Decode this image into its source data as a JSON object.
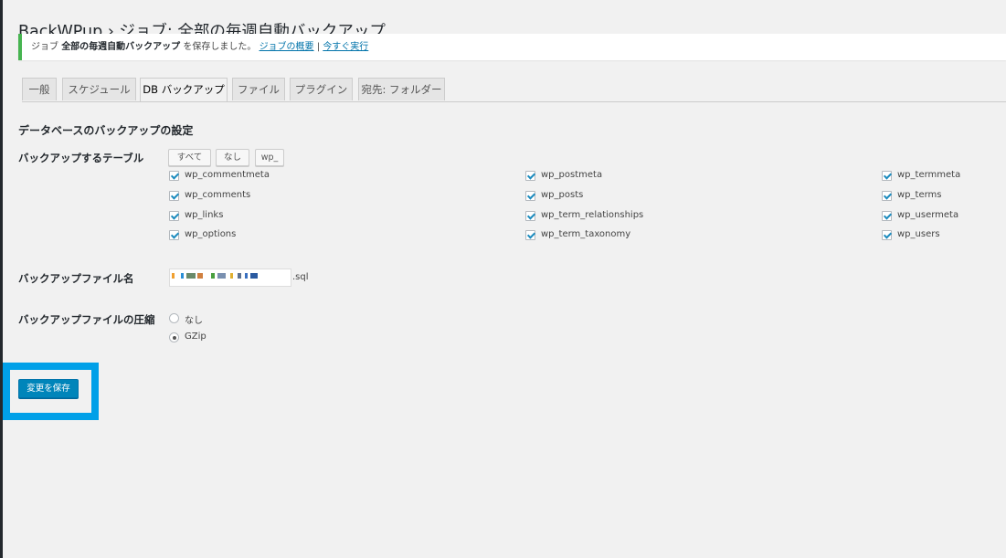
{
  "page": {
    "title_prefix": "BackWPup",
    "title_separator": "›",
    "title_rest": "ジョブ: 全部の毎週自動バックアップ"
  },
  "notice": {
    "prefix": "ジョブ",
    "job_name": "全部の毎週自動バックアップ",
    "saved_text": "を保存しました。",
    "overview_link": "ジョブの概要",
    "separator": "|",
    "run_now_link": "今すぐ実行"
  },
  "tabs": [
    {
      "label": "一般",
      "active": false
    },
    {
      "label": "スケジュール",
      "active": false
    },
    {
      "label": "DB バックアップ",
      "active": true
    },
    {
      "label": "ファイル",
      "active": false
    },
    {
      "label": "プラグイン",
      "active": false
    },
    {
      "label": "宛先: フォルダー",
      "active": false
    }
  ],
  "section_title": "データベースのバックアップの設定",
  "tables_section": {
    "label": "バックアップするテーブル",
    "buttons": [
      "すべて",
      "なし",
      "wp_"
    ],
    "columns": [
      [
        {
          "name": "wp_commentmeta",
          "checked": true
        },
        {
          "name": "wp_comments",
          "checked": true
        },
        {
          "name": "wp_links",
          "checked": true
        },
        {
          "name": "wp_options",
          "checked": true
        }
      ],
      [
        {
          "name": "wp_postmeta",
          "checked": true
        },
        {
          "name": "wp_posts",
          "checked": true
        },
        {
          "name": "wp_term_relationships",
          "checked": true
        },
        {
          "name": "wp_term_taxonomy",
          "checked": true
        }
      ],
      [
        {
          "name": "wp_termmeta",
          "checked": true
        },
        {
          "name": "wp_terms",
          "checked": true
        },
        {
          "name": "wp_usermeta",
          "checked": true
        },
        {
          "name": "wp_users",
          "checked": true
        }
      ]
    ]
  },
  "filename_section": {
    "label": "バックアップファイル名",
    "value": "",
    "extension": ".sql"
  },
  "compression_section": {
    "label": "バックアップファイルの圧縮",
    "options": [
      {
        "label": "なし",
        "checked": false
      },
      {
        "label": "GZip",
        "checked": true
      }
    ]
  },
  "save_button": "変更を保存",
  "colors": {
    "accent": "#0085ba",
    "link": "#0073aa",
    "notice_success": "#46b450",
    "highlight": "#00a0e8",
    "checkmark": "#1e8cbe"
  }
}
